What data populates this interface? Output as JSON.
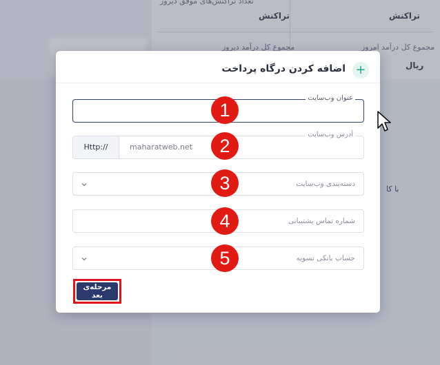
{
  "background": {
    "stat_top_left_label": "تعداد تراکنش‌های موفق دیروز",
    "stat_top_left_value": "تراکنش",
    "stat_top_right_value": "تراکنش",
    "stat_bottom_left_label": "مجموع کل درآمد دیروز",
    "stat_bottom_right_label": "مجموع کل درآمد امروز",
    "stat_bottom_right_value": "ریال",
    "side_text": "با کا"
  },
  "modal": {
    "title": "اضافه کردن درگاه پرداخت",
    "plus_symbol": "+",
    "fields": {
      "website_title": {
        "label": "عنوان وب‌سایت",
        "value": ""
      },
      "website_address": {
        "label": "آدرس وب‌سایت",
        "prefix": "Http://",
        "value": "maharatweb.net"
      },
      "website_category": {
        "placeholder": "دسته‌بندی وب‌سایت"
      },
      "support_phone": {
        "placeholder": "شماره تماس پشتیبانی"
      },
      "settlement_account": {
        "placeholder": "حساب بانکی تسویه"
      }
    },
    "next_button": "مرحله‌ی بعد"
  },
  "annotations": [
    "1",
    "2",
    "3",
    "4",
    "5"
  ],
  "colors": {
    "primary": "#2b3a6d",
    "annotation_red": "#e11b14",
    "accent_green": "#1aa78a"
  }
}
